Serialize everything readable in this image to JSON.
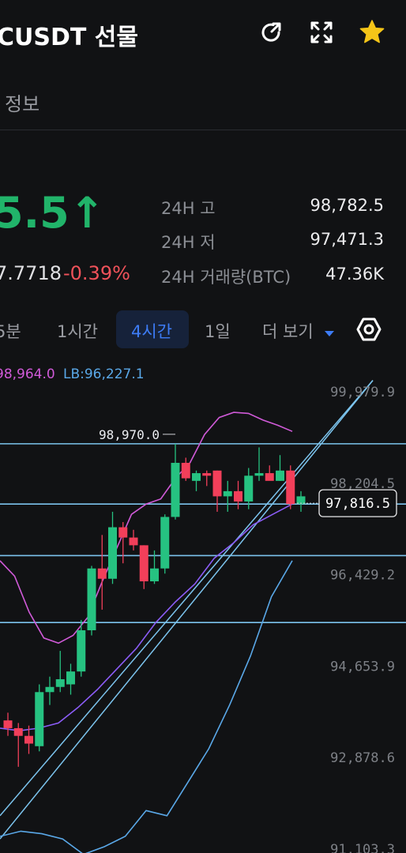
{
  "header": {
    "title": "CUSDT 선물",
    "icons": [
      "share-icon",
      "expand-icon",
      "star-icon"
    ]
  },
  "subtab": {
    "label": "정보"
  },
  "price": {
    "last": "5.5",
    "arrow": "↑",
    "index_price": "7.7718",
    "change_pct": "-0.39%"
  },
  "stats": [
    {
      "label": "24H 고",
      "value": "98,782.5"
    },
    {
      "label": "24H 저",
      "value": "97,471.3"
    },
    {
      "label": "24H 거래량(BTC)",
      "value": "47.36K"
    }
  ],
  "timeframes": {
    "items": [
      "5분",
      "1시간",
      "4시간",
      "1일",
      "더 보기"
    ],
    "active": "4시간"
  },
  "indicator": {
    "ub": "98,964.0",
    "lb": "LB:96,227.1"
  },
  "colors": {
    "up": "#21b46a",
    "down": "#f0525a",
    "candle_up": "#26c281",
    "candle_down": "#f23f5a",
    "accent": "#3d7cf5",
    "upper_band": "#d05ad8",
    "middle_band": "#8b5cf6",
    "lower_band": "#5aa8e8",
    "hline": "#7cc4ee"
  },
  "chart_data": {
    "type": "candlestick",
    "y_ticks": [
      "99,979.9",
      "98,204.5",
      "96,429.2",
      "94,653.9",
      "92,878.6",
      "91,103.3"
    ],
    "ylim": [
      91103.3,
      99979.9
    ],
    "high_marker": "98,970.0",
    "last_price_label": "97,816.5",
    "candles": [
      {
        "o": 93600,
        "h": 93750,
        "l": 93300,
        "c": 93450
      },
      {
        "o": 93450,
        "h": 93550,
        "l": 92700,
        "c": 93300
      },
      {
        "o": 93300,
        "h": 93500,
        "l": 92950,
        "c": 93150
      },
      {
        "o": 93100,
        "h": 94300,
        "l": 93000,
        "c": 94150
      },
      {
        "o": 94150,
        "h": 94450,
        "l": 93900,
        "c": 94250
      },
      {
        "o": 94250,
        "h": 94950,
        "l": 94150,
        "c": 94400
      },
      {
        "o": 94300,
        "h": 94700,
        "l": 94100,
        "c": 94550
      },
      {
        "o": 94550,
        "h": 95550,
        "l": 94450,
        "c": 95350
      },
      {
        "o": 95350,
        "h": 96600,
        "l": 95250,
        "c": 96550
      },
      {
        "o": 96550,
        "h": 97200,
        "l": 95750,
        "c": 96350
      },
      {
        "o": 96350,
        "h": 97650,
        "l": 96250,
        "c": 97350
      },
      {
        "o": 97350,
        "h": 97450,
        "l": 96650,
        "c": 97150
      },
      {
        "o": 97150,
        "h": 97300,
        "l": 96900,
        "c": 97000
      },
      {
        "o": 97000,
        "h": 97000,
        "l": 96150,
        "c": 96300
      },
      {
        "o": 96300,
        "h": 96900,
        "l": 96250,
        "c": 96550
      },
      {
        "o": 96550,
        "h": 97600,
        "l": 96450,
        "c": 97550
      },
      {
        "o": 97550,
        "h": 98970,
        "l": 97500,
        "c": 98600
      },
      {
        "o": 98600,
        "h": 98700,
        "l": 98250,
        "c": 98300
      },
      {
        "o": 98250,
        "h": 98450,
        "l": 98050,
        "c": 98400
      },
      {
        "o": 98400,
        "h": 98450,
        "l": 98150,
        "c": 98350
      },
      {
        "o": 98450,
        "h": 98450,
        "l": 97650,
        "c": 97950
      },
      {
        "o": 97950,
        "h": 98250,
        "l": 97650,
        "c": 98050
      },
      {
        "o": 98050,
        "h": 98250,
        "l": 97700,
        "c": 97850
      },
      {
        "o": 97850,
        "h": 98500,
        "l": 97700,
        "c": 98350
      },
      {
        "o": 98350,
        "h": 98900,
        "l": 98250,
        "c": 98400
      },
      {
        "o": 98400,
        "h": 98550,
        "l": 98300,
        "c": 98250
      },
      {
        "o": 98250,
        "h": 98750,
        "l": 98250,
        "c": 98450
      },
      {
        "o": 98450,
        "h": 98550,
        "l": 97700,
        "c": 97800
      },
      {
        "o": 97800,
        "h": 98050,
        "l": 97650,
        "c": 97950
      }
    ],
    "horizontal_levels": [
      98970,
      97800,
      96800,
      95500
    ],
    "upper_band": [
      96700,
      96400,
      95700,
      95200,
      95100,
      95250,
      95600,
      96300,
      96950,
      97600,
      97800,
      97900,
      98300,
      98600,
      99150,
      99480,
      99580,
      99560,
      99430,
      99330,
      99210
    ],
    "middle_band": [
      93450,
      93400,
      93450,
      93550,
      93850,
      94200,
      94600,
      95000,
      95500,
      95900,
      96250,
      96750,
      97050,
      97400,
      97600,
      97800
    ],
    "lower_band": [
      91350,
      91450,
      91400,
      91300,
      91000,
      91150,
      91350,
      91850,
      91750,
      92400,
      93050,
      93900,
      94850,
      96000,
      96700
    ]
  }
}
